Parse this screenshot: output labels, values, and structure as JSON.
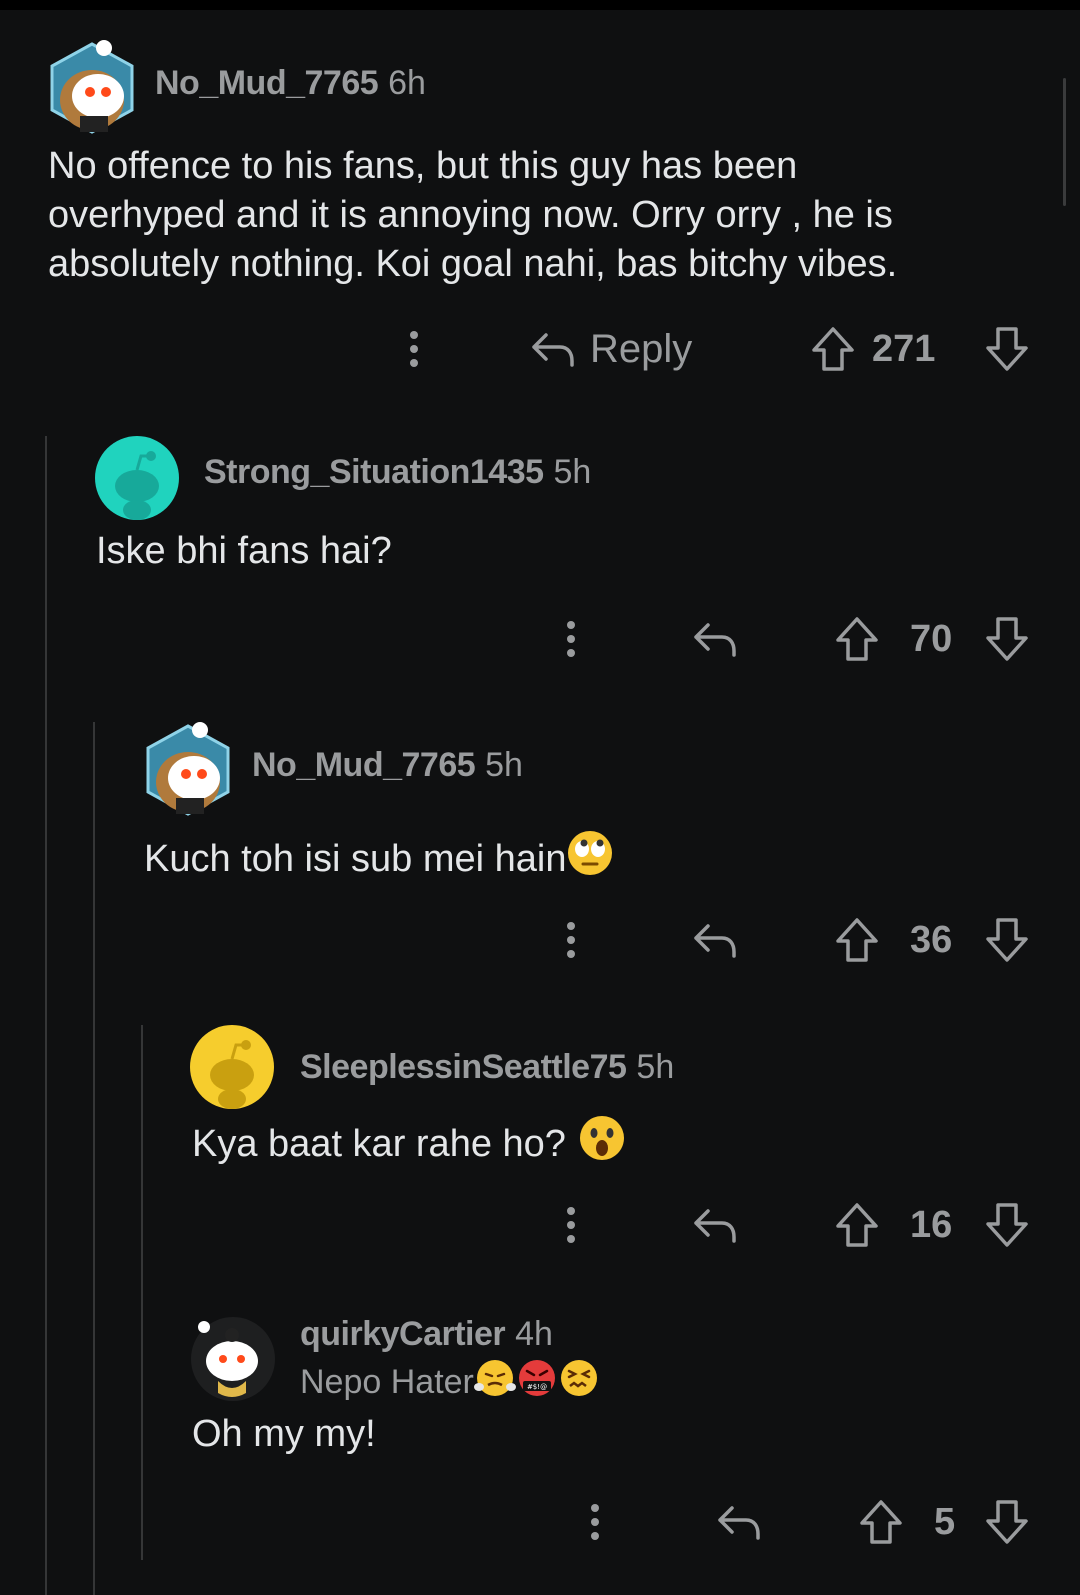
{
  "comments": [
    {
      "username": "No_Mud_7765",
      "age": "6h",
      "body_lines": [
        "No offence to his fans, but this guy has been",
        "overhyped and it is annoying now. Orry orry , he is",
        "absolutely nothing. Koi goal nahi, bas bitchy vibes."
      ],
      "reply_label": "Reply",
      "score": "271",
      "avatar_icon": "snoo-avatar-icon"
    },
    {
      "username": "Strong_Situation1435",
      "age": "5h",
      "body": "Iske bhi fans hai?",
      "score": "70",
      "avatar_icon": "default-snoo-icon",
      "avatar_color": "#20d3be"
    },
    {
      "username": "No_Mud_7765",
      "age": "5h",
      "body": "Kuch toh isi sub mei hain",
      "body_emoji": "rolling-eyes-emoji",
      "score": "36",
      "avatar_icon": "snoo-avatar-icon"
    },
    {
      "username": "SleeplessinSeattle75",
      "age": "5h",
      "body": "Kya baat kar rahe ho?",
      "body_emoji": "astonished-emoji",
      "score": "16",
      "avatar_icon": "default-snoo-icon",
      "avatar_color": "#f6cd2d"
    },
    {
      "username": "quirkyCartier",
      "age": "4h",
      "flair": "Nepo Hater",
      "flair_emojis": [
        "steam-nose-emoji",
        "cursing-face-emoji",
        "confounded-face-emoji"
      ],
      "body": "Oh my my!",
      "score": "5",
      "avatar_icon": "snoo-avatar-icon"
    }
  ],
  "colors": {
    "background": "#0f1011",
    "text": "#e4e6e8",
    "muted": "#9a9c9e",
    "thread_line": "#353637"
  }
}
